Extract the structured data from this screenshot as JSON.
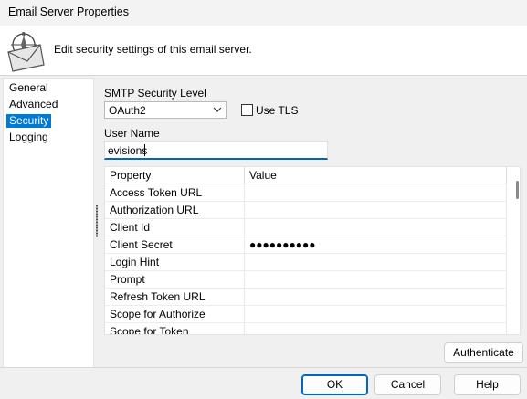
{
  "window": {
    "title": "Email Server Properties"
  },
  "header": {
    "description": "Edit security settings of this email server.",
    "icon": "email-compass-icon"
  },
  "nav": {
    "items": [
      {
        "label": "General"
      },
      {
        "label": "Advanced"
      },
      {
        "label": "Security"
      },
      {
        "label": "Logging"
      }
    ],
    "selected": "Security"
  },
  "form": {
    "smtp_label": "SMTP Security Level",
    "smtp_value": "OAuth2",
    "use_tls_label": "Use TLS",
    "use_tls_checked": false,
    "username_label": "User Name",
    "username_value": "evisions"
  },
  "grid": {
    "headers": [
      "Property",
      "Value"
    ],
    "rows": [
      {
        "property": "Access Token URL",
        "value": ""
      },
      {
        "property": "Authorization URL",
        "value": ""
      },
      {
        "property": "Client Id",
        "value": ""
      },
      {
        "property": "Client Secret",
        "value": "●●●●●●●●●●"
      },
      {
        "property": "Login Hint",
        "value": ""
      },
      {
        "property": "Prompt",
        "value": ""
      },
      {
        "property": "Refresh Token URL",
        "value": ""
      },
      {
        "property": "Scope for Authorize",
        "value": ""
      },
      {
        "property": "Scope for Token",
        "value": ""
      }
    ]
  },
  "buttons": {
    "authenticate": "Authenticate",
    "ok": "OK",
    "cancel": "Cancel",
    "help": "Help"
  },
  "colors": {
    "accent": "#0078d7",
    "focus": "#0067c0"
  }
}
